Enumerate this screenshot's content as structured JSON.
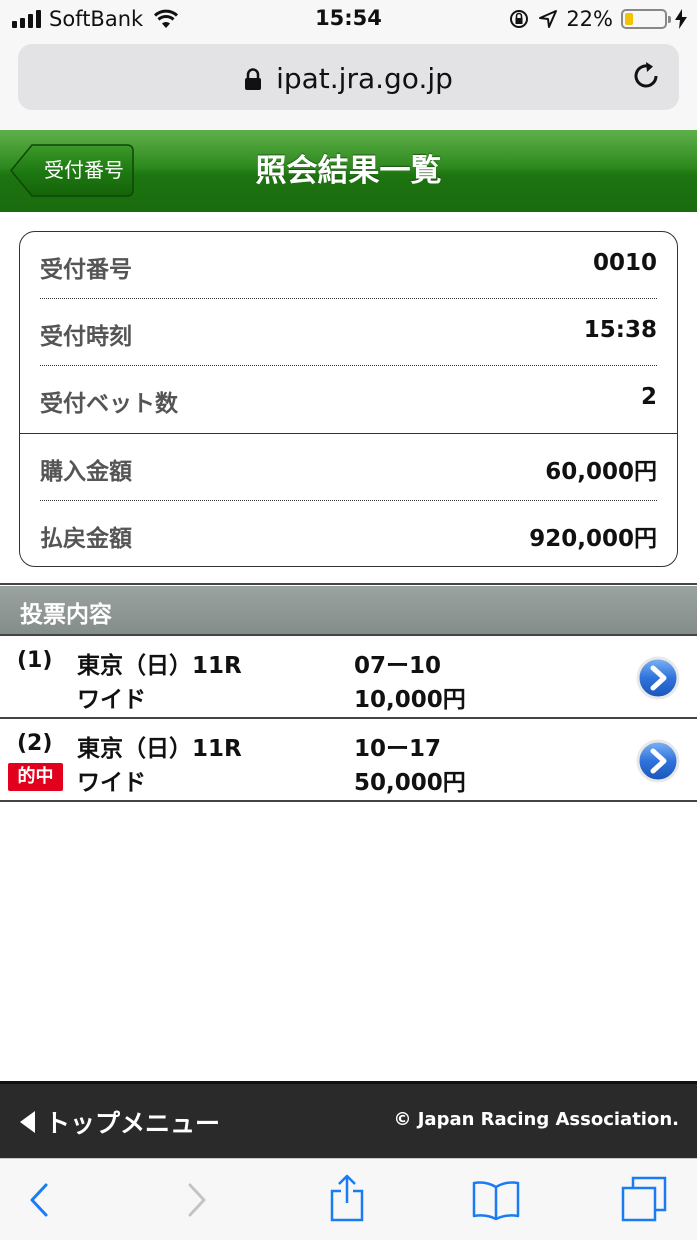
{
  "status_bar": {
    "carrier": "SoftBank",
    "time": "15:54",
    "battery_percent": "22%",
    "battery_level": 0.22,
    "battery_color": "#f2c200"
  },
  "browser": {
    "url": "ipat.jra.go.jp",
    "icons": [
      "lock-icon",
      "reload-icon"
    ]
  },
  "header": {
    "back_label": "受付番号",
    "title": "照会結果一覧",
    "color": "#2e8a1e"
  },
  "summary": {
    "rows": [
      {
        "label": "受付番号",
        "value": "0010"
      },
      {
        "label": "受付時刻",
        "value": "15:38"
      },
      {
        "label": "受付ベット数",
        "value": "2"
      },
      {
        "label": "購入金額",
        "value": "60,000円"
      },
      {
        "label": "払戻金額",
        "value": "920,000円"
      }
    ]
  },
  "section": {
    "title": "投票内容"
  },
  "bets": [
    {
      "num": "(1)",
      "race": "東京（日）11R",
      "type": "ワイド",
      "combo": "07ー10",
      "amount": "10,000円",
      "hit": ""
    },
    {
      "num": "(2)",
      "race": "東京（日）11R",
      "type": "ワイド",
      "combo": "10ー17",
      "amount": "50,000円",
      "hit": "的中"
    }
  ],
  "footer": {
    "menu_label": "トップメニュー",
    "copyright": "© Japan Racing Association."
  },
  "toolbar": {
    "icons": [
      "back-icon",
      "forward-icon",
      "share-icon",
      "bookmarks-icon",
      "tabs-icon"
    ]
  }
}
